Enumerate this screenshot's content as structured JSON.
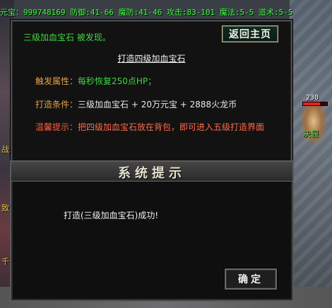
{
  "status": {
    "text": "元宝：999748169 防御:41-66 魔防:41-46 攻击:83-101 魔法:5-5 道术:5-5"
  },
  "top_dialog": {
    "found_text": "三级加血宝石 被发现。",
    "return_button": "返回主页",
    "craft_link": "打造四级加血宝石",
    "effect_label": "触发属性：",
    "effect_value": "每秒恢复250点HP；",
    "condition_label": "打造条件：",
    "condition_value": "三级加血宝石 + 20万元宝 + 2888火龙币",
    "tip_label": "温馨提示：",
    "tip_value": "把四级加血宝石放在背包，即可进入五级打造界面"
  },
  "bottom_dialog": {
    "title": "系统提示",
    "message": "打造(三级加血宝石)成功!",
    "ok_button": "确定"
  },
  "character": {
    "hp_text": "230",
    "name": "决裂",
    "hp_fraction": 0.7
  },
  "left_edge": {
    "glyph1": "战",
    "glyph2": "致",
    "glyph3": "千"
  },
  "colors": {
    "status_green": "#3cff3c",
    "label_orange": "#e8a040",
    "label_red": "#ff5a3c",
    "value_green": "#3fd63f"
  }
}
